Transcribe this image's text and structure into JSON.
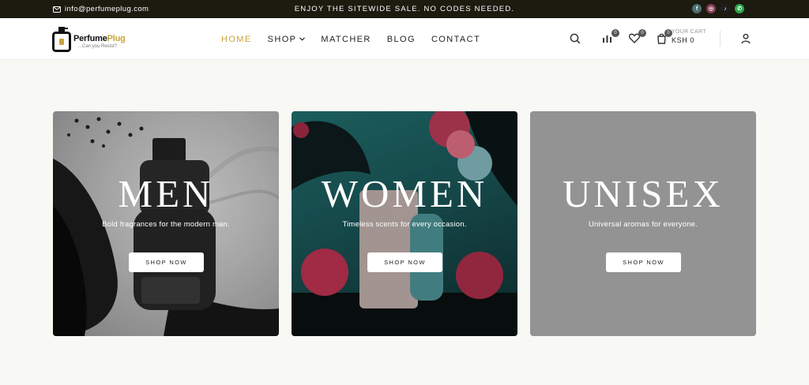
{
  "topbar": {
    "email": "info@perfumeplug.com",
    "promo": "ENJOY THE SITEWIDE SALE. NO CODES NEEDED.",
    "social": [
      {
        "icon": "facebook-icon",
        "glyph": "f",
        "color": "#4a6f6f"
      },
      {
        "icon": "instagram-icon",
        "glyph": "◎",
        "color": "#8a3f56"
      },
      {
        "icon": "tiktok-icon",
        "glyph": "♪",
        "color": "#1e1e1e"
      },
      {
        "icon": "whatsapp-icon",
        "glyph": "✆",
        "color": "#2aa84a"
      }
    ]
  },
  "header": {
    "logo": {
      "name_part1": "Perfume",
      "name_part2": "Plug",
      "tagline": "...Can you Resist?"
    },
    "nav": [
      {
        "label": "HOME",
        "active": true
      },
      {
        "label": "SHOP",
        "active": false,
        "has_dropdown": true
      },
      {
        "label": "MATCHER",
        "active": false
      },
      {
        "label": "BLOG",
        "active": false
      },
      {
        "label": "CONTACT",
        "active": false
      }
    ],
    "compare_count": "0",
    "wishlist_count": "0",
    "cart_count": "0",
    "cart_label": "YOUR CART",
    "cart_amount": "KSH 0",
    "accent_color": "#c9a33b"
  },
  "cards": [
    {
      "title": "MEN",
      "subtitle": "Bold fragrances for the modern man.",
      "button": "SHOP NOW"
    },
    {
      "title": "WOMEN",
      "subtitle": "Timeless scents for every occasion.",
      "button": "SHOP NOW"
    },
    {
      "title": "UNISEX",
      "subtitle": "Universal aromas for everyone.",
      "button": "SHOP NOW"
    }
  ]
}
